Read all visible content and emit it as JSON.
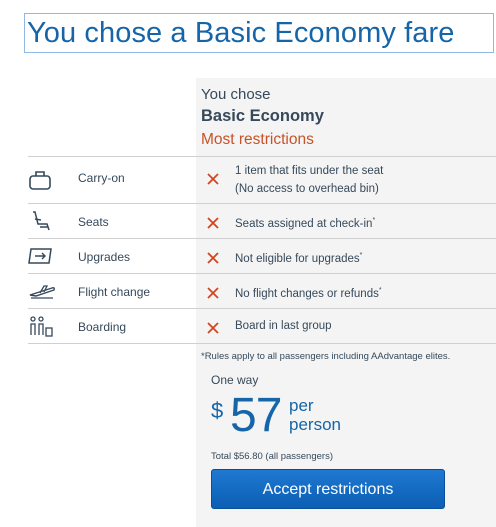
{
  "page": {
    "title": "You chose a Basic Economy fare"
  },
  "fare": {
    "chose_label": "You chose",
    "name": "Basic Economy",
    "restriction_level": "Most restrictions"
  },
  "rows": [
    {
      "label": "Carry-on",
      "icon": "carry-on-bag-icon",
      "desc_line1": "1 item that fits under the seat",
      "desc_line2": "(No access to overhead bin)",
      "restricted": true
    },
    {
      "label": "Seats",
      "icon": "seat-icon",
      "desc": "Seats assigned at check-in",
      "footnote_mark": "*",
      "restricted": true
    },
    {
      "label": "Upgrades",
      "icon": "upgrade-ticket-icon",
      "desc": "Not eligible for upgrades",
      "footnote_mark": "*",
      "restricted": true
    },
    {
      "label": "Flight change",
      "icon": "airplane-icon",
      "desc": "No flight changes or refunds",
      "footnote_mark": "*",
      "restricted": true
    },
    {
      "label": "Boarding",
      "icon": "boarding-group-icon",
      "desc": "Board in last group",
      "restricted": true
    }
  ],
  "footnote": "*Rules apply to all passengers including AAdvantage elites.",
  "price": {
    "trip_type": "One way",
    "currency": "$",
    "amount": "57",
    "per_line1": "per",
    "per_line2": "person",
    "total": "Total $56.80 (all passengers)"
  },
  "actions": {
    "accept_label": "Accept restrictions"
  },
  "colors": {
    "brand_blue": "#1565a8",
    "restriction_orange": "#c65328",
    "x_mark": "#d1461f",
    "button_blue": "#0b5fb4"
  }
}
